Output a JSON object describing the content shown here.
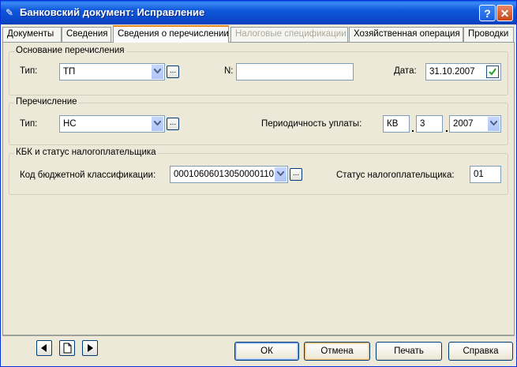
{
  "window": {
    "title": "Банковский документ: Исправление"
  },
  "tabs": [
    {
      "label": "Документы"
    },
    {
      "label": "Сведения"
    },
    {
      "label": "Сведения о перечислении"
    },
    {
      "label": "Налоговые спецификации"
    },
    {
      "label": "Хозяйственная операция"
    },
    {
      "label": "Проводки"
    }
  ],
  "groups": {
    "basis": {
      "title": "Основание перечисления",
      "type_label": "Тип:",
      "type_value": "ТП",
      "number_label": "N:",
      "number_value": "",
      "date_label": "Дата:",
      "date_value": "31.10.2007",
      "date_checked": true
    },
    "transfer": {
      "title": "Перечисление",
      "type_label": "Тип:",
      "type_value": "НС",
      "period_label": "Периодичность уплаты:",
      "period_code": "КВ",
      "period_number": "3",
      "period_year": "2007"
    },
    "kbk": {
      "title": "КБК и статус налогоплательщика",
      "code_label": "Код бюджетной классификации:",
      "code_value": "00010606013050000110",
      "status_label": "Статус налогоплательщика:",
      "status_value": "01"
    }
  },
  "buttons": {
    "ok": "ОК",
    "cancel": "Отмена",
    "print": "Печать",
    "help": "Справка"
  },
  "icons": {
    "app": "document-icon",
    "help": "question-icon",
    "close": "close-icon",
    "prev": "arrow-left-icon",
    "new": "new-document-icon",
    "next": "arrow-right-icon"
  }
}
